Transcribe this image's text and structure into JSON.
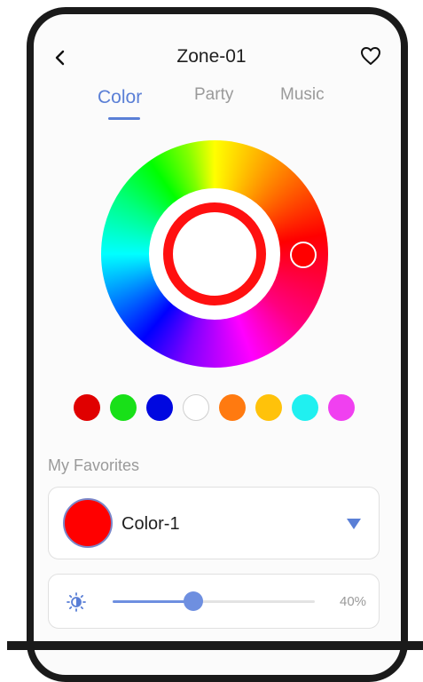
{
  "header": {
    "title": "Zone-01",
    "back_icon": "chevron-left-icon",
    "favorite_icon": "heart-outline-icon"
  },
  "tabs": [
    {
      "label": "Color",
      "active": true
    },
    {
      "label": "Party",
      "active": false
    },
    {
      "label": "Music",
      "active": false
    }
  ],
  "color_wheel": {
    "selected_color": "#ff0000",
    "handle_icon": "wheel-handle"
  },
  "preset_colors": [
    "#e00000",
    "#18e018",
    "#0008e0",
    "#ffffff",
    "#ff7a10",
    "#ffc20a",
    "#20f0f0",
    "#f040f0"
  ],
  "favorites": {
    "section_label": "My Favorites",
    "current_name": "Color-1",
    "current_color": "#ff0000",
    "dropdown_icon": "triangle-down-icon"
  },
  "brightness": {
    "icon": "brightness-icon",
    "value_label": "40%",
    "value_fraction": 0.4
  },
  "colors": {
    "accent": "#5a7fd6",
    "slider": "#6e8fe0"
  }
}
